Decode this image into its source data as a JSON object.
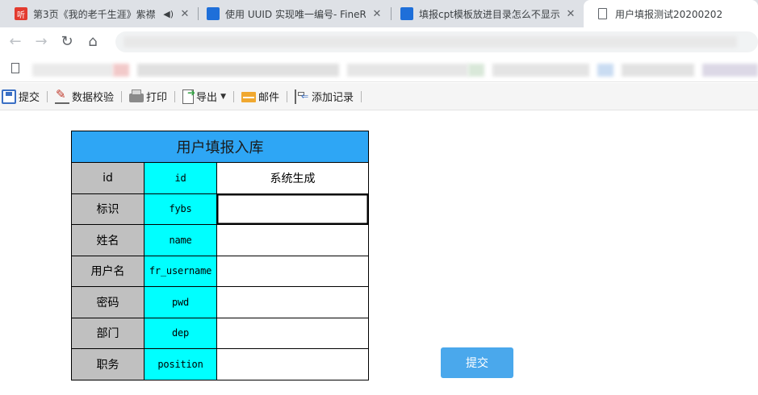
{
  "browser": {
    "tabs": [
      {
        "title": "第3页《我的老千生涯》紫襟",
        "favicon": "ting-logo",
        "audio": true
      },
      {
        "title": "使用 UUID 实现唯一编号- FineR",
        "favicon": "finereport-logo"
      },
      {
        "title": "填报cpt模板放进目录怎么不显示",
        "favicon": "finereport-logo"
      },
      {
        "title": "用户填报测试20200202",
        "favicon": "page-icon",
        "active": true
      }
    ],
    "close_glyph": "✕",
    "favicon_ting_text": "听"
  },
  "toolbar": {
    "submit": "提交",
    "validate": "数据校验",
    "print": "打印",
    "export": "导出",
    "email": "邮件",
    "add_record": "添加记录"
  },
  "form": {
    "title": "用户填报入库",
    "rows": [
      {
        "label": "id",
        "field": "id",
        "value": "系统生成"
      },
      {
        "label": "标识",
        "field": "fybs",
        "value": ""
      },
      {
        "label": "姓名",
        "field": "name",
        "value": ""
      },
      {
        "label": "用户名",
        "field": "fr_username",
        "value": ""
      },
      {
        "label": "密码",
        "field": "pwd",
        "value": ""
      },
      {
        "label": "部门",
        "field": "dep",
        "value": ""
      },
      {
        "label": "职务",
        "field": "position",
        "value": ""
      }
    ],
    "submit_button": "提交"
  },
  "colors": {
    "header_bg": "#2ea6f5",
    "label_bg": "#c0c0c0",
    "field_bg": "#00ffff",
    "submit_bg": "#4aa8ec"
  }
}
